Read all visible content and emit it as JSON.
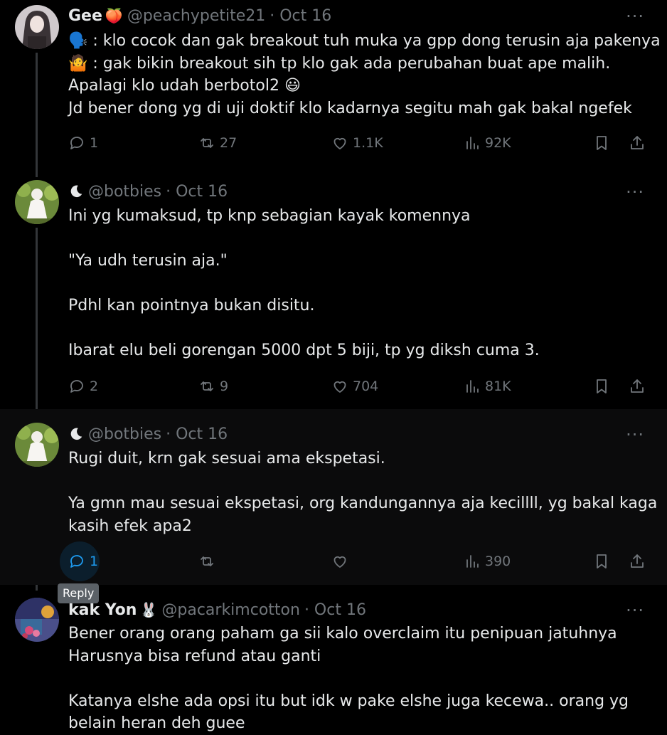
{
  "tweets": [
    {
      "name": "Gee",
      "name_emoji": "🍑",
      "handle": "@peachypetite21",
      "date": "· Oct 16",
      "lines": [
        "🗣️ : klo cocok dan gak breakout tuh muka ya gpp dong terusin aja pakenya",
        "🤷 : gak bikin breakout sih tp klo gak ada perubahan buat ape malih.",
        "Apalagi klo udah berbotol2 😃",
        "Jd bener dong yg di uji doktif klo kadarnya segitu mah gak bakal ngefek"
      ],
      "replies": "1",
      "retweets": "27",
      "likes": "1.1K",
      "views": "92K"
    },
    {
      "name": "",
      "handle": "@botbies",
      "date": "· Oct 16",
      "lines": [
        "Ini yg kumaksud, tp knp sebagian kayak komennya",
        "",
        "\"Ya udh terusin aja.\"",
        "",
        "Pdhl kan pointnya bukan disitu.",
        "",
        "Ibarat elu beli gorengan 5000 dpt 5 biji, tp yg diksh cuma 3."
      ],
      "replies": "2",
      "retweets": "9",
      "likes": "704",
      "views": "81K"
    },
    {
      "name": "",
      "handle": "@botbies",
      "date": "· Oct 16",
      "lines": [
        "Rugi duit, krn gak sesuai ama ekspetasi.",
        "",
        "Ya gmn mau sesuai ekspetasi, org kandungannya aja kecillll, yg bakal kaga",
        "kasih efek apa2"
      ],
      "replies": "1",
      "retweets": "",
      "likes": "",
      "views": "390"
    },
    {
      "name": "kak Yon",
      "name_emoji": "🐰",
      "handle": "@pacarkimcotton",
      "date": "· Oct 16",
      "lines": [
        "Bener orang orang paham ga sii kalo overclaim itu penipuan jatuhnya",
        "Harusnya bisa refund atau ganti",
        "",
        "Katanya elshe ada opsi itu but idk w pake elshe juga kecewa.. orang yg",
        "belain heran deh guee"
      ]
    }
  ],
  "more_label": "···",
  "tooltip": "Reply",
  "colors": {
    "bg": "#000000",
    "text": "#e7e9ea",
    "muted": "#71767b",
    "accent": "#1d9bf0"
  }
}
